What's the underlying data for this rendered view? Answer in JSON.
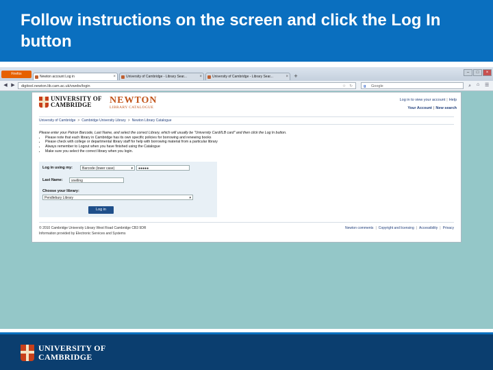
{
  "slide": {
    "title": "Follow instructions on the screen and click the Log In button"
  },
  "browser": {
    "firefox_label": "Firefox",
    "tabs": [
      {
        "label": "Newton account Log in",
        "active": true
      },
      {
        "label": "University of Cambridge - Library Sear...",
        "active": false
      },
      {
        "label": "University of Cambridge - Library Sear...",
        "active": false
      }
    ],
    "url": "digitool.newton.lib.cam.ac.uk/vwebv/login",
    "search_placeholder": "Google"
  },
  "page": {
    "uc_logo_lines": [
      "UNIVERSITY OF",
      "CAMBRIDGE"
    ],
    "newton_title": "NEWTON",
    "newton_subtitle": "LIBRARY CATALOGUE",
    "account_line1": "Log in to view your account",
    "help": "Help",
    "your_account": "Your Account",
    "new_search": "New search",
    "breadcrumbs": [
      "University of Cambridge",
      "Cambridge University Library",
      "Newton Library Catalogue"
    ],
    "instructions_intro": "Please enter your Patron Barcode, Last Name, and select the correct Library, which will usually be \"University Card/ILB card\" and then click the Log In button.",
    "instructions": [
      "Please note that each library in Cambridge has its own specific policies for borrowing and renewing books",
      "Please check with college or departmental library staff for help with borrowing material from a particular library",
      "Always remember to Logout when you have finished using the Catalogue",
      "Make sure you select the correct library when you login."
    ],
    "login_using_label": "Log in using my:",
    "login_using_value": "Barcode (lower case)",
    "barcode_value": "●●●●●",
    "last_name_label": "Last Name:",
    "last_name_value": "snelling",
    "library_label": "Choose your library:",
    "library_value": "Pendlebury Library",
    "login_button": "Log in",
    "footer_copyright": "© 2010 Cambridge University Library West Road Cambridge CB3 9DR",
    "footer_info": "Information provided by Electronic Services and Systems",
    "footer_links": [
      "Newton comments",
      "Copyright and licensing",
      "Accessibility",
      "Privacy"
    ]
  },
  "footer": {
    "wordmark_lines": [
      "UNIVERSITY OF",
      "CAMBRIDGE"
    ]
  },
  "colors": {
    "header_blue": "#0a6fbf",
    "footer_navy": "#0b3e6f",
    "newton_orange": "#c05218",
    "login_button": "#1f4f8a"
  }
}
